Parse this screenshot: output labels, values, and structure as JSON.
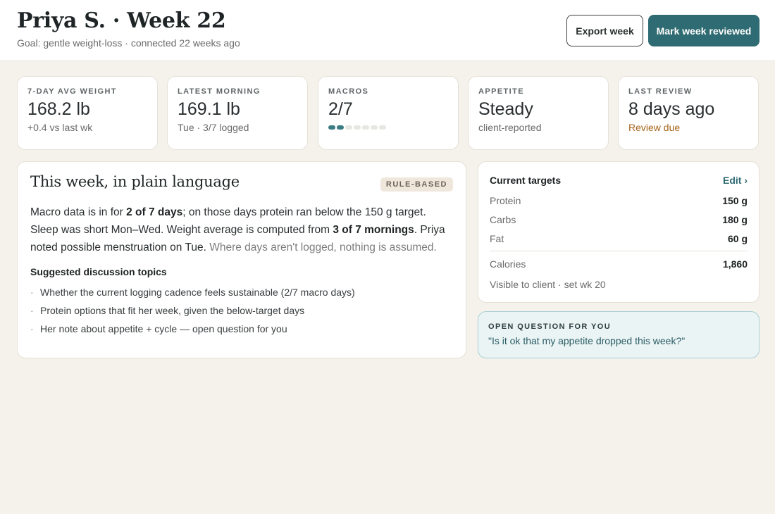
{
  "header": {
    "title": "Priya S. · Week 22",
    "subtitle": "Goal: gentle weight-loss · connected 22 weeks ago",
    "export_label": "Export week",
    "review_label": "Mark week reviewed"
  },
  "stats": [
    {
      "label": "7-DAY AVG WEIGHT",
      "value": "168.2 lb",
      "sub": "+0.4 vs last wk"
    },
    {
      "label": "LATEST MORNING",
      "value": "169.1 lb",
      "sub": "Tue · 3/7 logged"
    },
    {
      "label": "MACROS",
      "value": "2/7",
      "logged_days": 2,
      "total_days": 7
    },
    {
      "label": "APPETITE",
      "value": "Steady",
      "sub": "client-reported"
    },
    {
      "label": "LAST REVIEW",
      "value": "8 days ago",
      "sub": "Review due"
    }
  ],
  "summary": {
    "title": "This week, in plain language",
    "badge": "RULE-BASED",
    "p1": "Macro data is in for ",
    "b1": "2 of 7 days",
    "p2": "; on those days protein ran below the 150 g target. Sleep was short Mon–Wed. Weight average is computed from ",
    "b2": "3 of 7 mornings",
    "p3": ". Priya noted possible menstruation on Tue. ",
    "muted": "Where days aren't logged, nothing is assumed.",
    "topics_title": "Suggested discussion topics",
    "topics": [
      "Whether the current logging cadence feels sustainable (2/7 macro days)",
      "Protein options that fit her week, given the below-target days",
      "Her note about appetite + cycle — open question for you"
    ],
    "bullet": "·"
  },
  "targets": {
    "title": "Current targets",
    "edit_label": "Edit ›",
    "rows": [
      {
        "label": "Protein",
        "value": "150 g"
      },
      {
        "label": "Carbs",
        "value": "180 g"
      },
      {
        "label": "Fat",
        "value": "60 g"
      }
    ],
    "calories": {
      "label": "Calories",
      "value": "1,860"
    },
    "visibility": "Visible to client · set wk 20"
  },
  "question": {
    "label": "OPEN QUESTION FOR YOU",
    "text": "\"Is it ok that my appetite dropped this week?\""
  },
  "colors": {
    "accent": "#2f6b72",
    "background": "#f5f2ec",
    "warning": "#a8641a",
    "question_bg": "#eaf4f5"
  }
}
